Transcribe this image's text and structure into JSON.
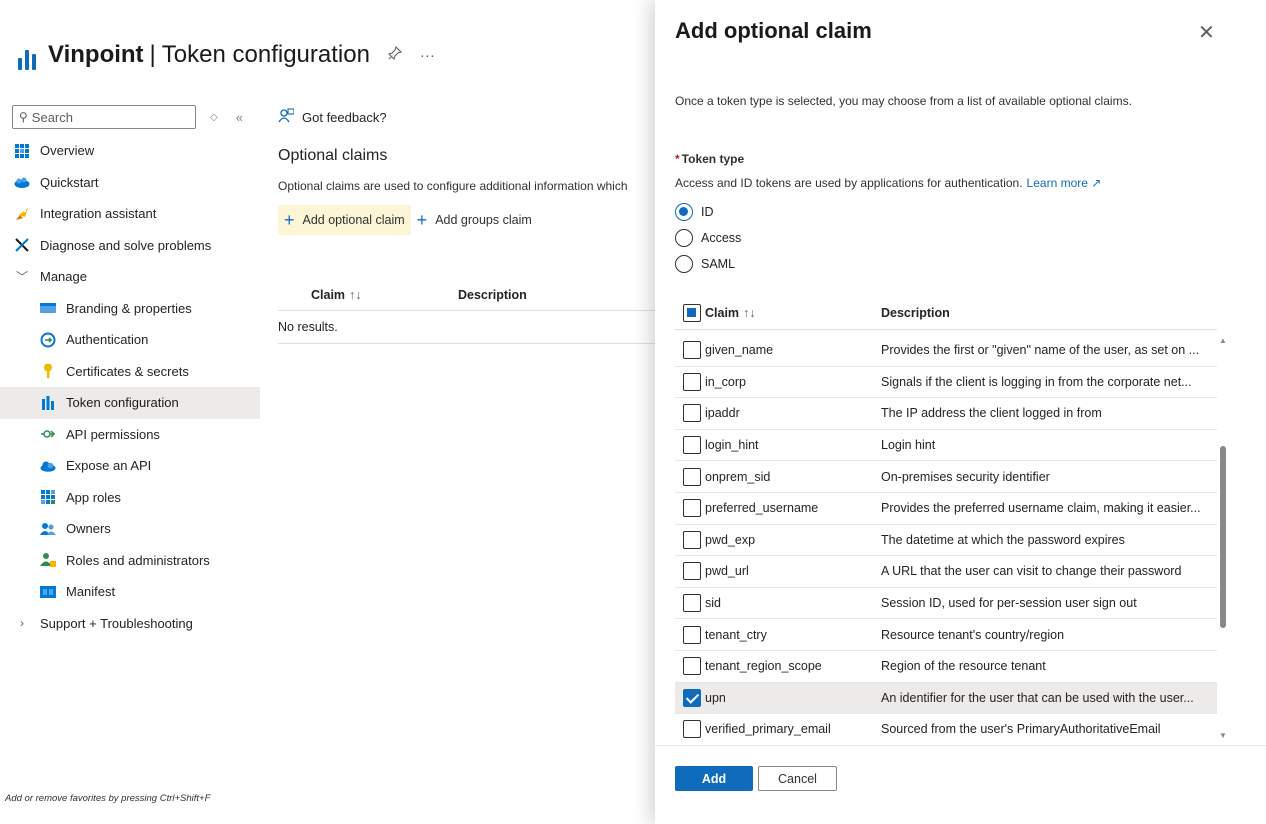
{
  "header": {
    "app_name": "Vinpoint",
    "separator": "|",
    "page_name": "Token configuration",
    "pin_icon": "pin-icon",
    "more_glyph": "···"
  },
  "sidebar": {
    "search_placeholder": "Search",
    "items": [
      {
        "label": "Overview",
        "icon": "grid-icon",
        "color": "#0078d4"
      },
      {
        "label": "Quickstart",
        "icon": "cloud-people-icon",
        "color": "#0078d4"
      },
      {
        "label": "Integration assistant",
        "icon": "rocket-icon",
        "color": "#f7b500"
      },
      {
        "label": "Diagnose and solve problems",
        "icon": "wrench-icon",
        "color": "#1b1a19"
      },
      {
        "label": "Manage",
        "icon": "chevron-down-icon"
      },
      {
        "label": "Branding & properties",
        "icon": "card-icon",
        "color": "#0078d4"
      },
      {
        "label": "Authentication",
        "icon": "auth-icon",
        "color": "#0078d4"
      },
      {
        "label": "Certificates & secrets",
        "icon": "key-icon",
        "color": "#f7b500"
      },
      {
        "label": "Token configuration",
        "icon": "token-icon",
        "color": "#0078d4",
        "active": true
      },
      {
        "label": "API permissions",
        "icon": "api-arrow-icon",
        "color": "#2e8b57"
      },
      {
        "label": "Expose an API",
        "icon": "cloud-icon",
        "color": "#0078d4"
      },
      {
        "label": "App roles",
        "icon": "grid-icon",
        "color": "#0078d4"
      },
      {
        "label": "Owners",
        "icon": "people-icon",
        "color": "#0078d4"
      },
      {
        "label": "Roles and administrators",
        "icon": "person-badge-icon",
        "color": "#2e8b57"
      },
      {
        "label": "Manifest",
        "icon": "manifest-icon",
        "color": "#0078d4"
      },
      {
        "label": "Support + Troubleshooting",
        "icon": "chevron-right-icon"
      }
    ],
    "favorites_hint": "Add or remove favorites by pressing Ctrl+Shift+F"
  },
  "main": {
    "feedback_label": "Got feedback?",
    "section_title": "Optional claims",
    "section_desc": "Optional claims are used to configure additional information which",
    "add_optional_claim": "Add optional claim",
    "add_groups_claim": "Add groups claim",
    "table_headers": {
      "claim": "Claim",
      "sort_glyph": "↑↓",
      "description": "Description"
    },
    "empty_text": "No results."
  },
  "panel": {
    "title": "Add optional claim",
    "close_glyph": "✕",
    "intro": "Once a token type is selected, you may choose from a list of available optional claims.",
    "token_type_label": "Token type",
    "required_mark": "*",
    "token_type_desc": "Access and ID tokens are used by applications for authentication.",
    "learn_more": "Learn more",
    "token_types": [
      {
        "label": "ID",
        "selected": true
      },
      {
        "label": "Access",
        "selected": false
      },
      {
        "label": "SAML",
        "selected": false
      }
    ],
    "table_headers": {
      "claim": "Claim",
      "sort_glyph": "↑↓",
      "description": "Description"
    },
    "claims": [
      {
        "name": "given_name",
        "description": "Provides the first or \"given\" name of the user, as set on ...",
        "checked": false
      },
      {
        "name": "in_corp",
        "description": "Signals if the client is logging in from the corporate net...",
        "checked": false
      },
      {
        "name": "ipaddr",
        "description": "The IP address the client logged in from",
        "checked": false
      },
      {
        "name": "login_hint",
        "description": "Login hint",
        "checked": false
      },
      {
        "name": "onprem_sid",
        "description": "On-premises security identifier",
        "checked": false
      },
      {
        "name": "preferred_username",
        "description": "Provides the preferred username claim, making it easier...",
        "checked": false
      },
      {
        "name": "pwd_exp",
        "description": "The datetime at which the password expires",
        "checked": false
      },
      {
        "name": "pwd_url",
        "description": "A URL that the user can visit to change their password",
        "checked": false
      },
      {
        "name": "sid",
        "description": "Session ID, used for per-session user sign out",
        "checked": false
      },
      {
        "name": "tenant_ctry",
        "description": "Resource tenant's country/region",
        "checked": false
      },
      {
        "name": "tenant_region_scope",
        "description": "Region of the resource tenant",
        "checked": false
      },
      {
        "name": "upn",
        "description": "An identifier for the user that can be used with the user...",
        "checked": true
      },
      {
        "name": "verified_primary_email",
        "description": "Sourced from the user's PrimaryAuthoritativeEmail",
        "checked": false
      }
    ],
    "add_label": "Add",
    "cancel_label": "Cancel"
  },
  "colors": {
    "accent": "#0f6cbd",
    "highlight": "#fcf6d7",
    "selected_row": "#edebe9"
  }
}
